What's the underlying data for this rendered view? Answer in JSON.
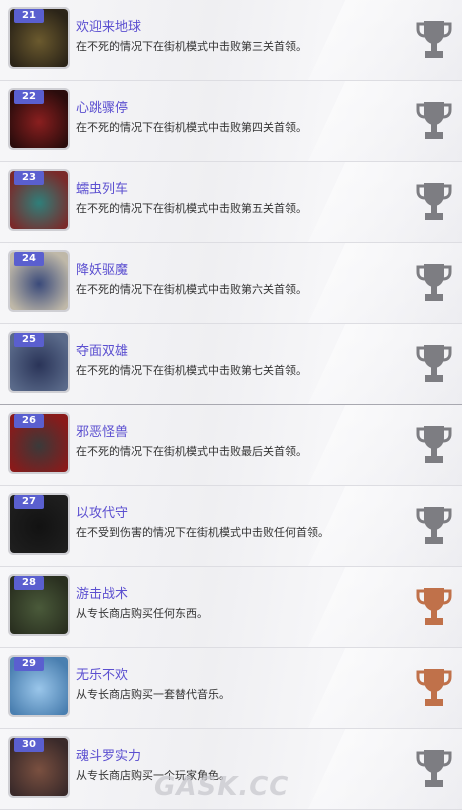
{
  "achievements": [
    {
      "num": "21",
      "title": "欢迎来地球",
      "desc": "在不死的情况下在街机模式中击败第三关首领。",
      "trophy": "silver-trophy-icon",
      "trophy_color": "#7d7d82",
      "art": [
        "#6b5a2e",
        "#2b2418"
      ]
    },
    {
      "num": "22",
      "title": "心跳骤停",
      "desc": "在不死的情况下在街机模式中击败第四关首领。",
      "trophy": "silver-trophy-icon",
      "trophy_color": "#7d7d82",
      "art": [
        "#8a1f1f",
        "#2a0c0c"
      ]
    },
    {
      "num": "23",
      "title": "蠕虫列车",
      "desc": "在不死的情况下在街机模式中击败第五关首领。",
      "trophy": "silver-trophy-icon",
      "trophy_color": "#7d7d82",
      "art": [
        "#2f7f7a",
        "#7a2a2a"
      ]
    },
    {
      "num": "24",
      "title": "降妖驱魔",
      "desc": "在不死的情况下在街机模式中击败第六关首领。",
      "trophy": "silver-trophy-icon",
      "trophy_color": "#7d7d82",
      "art": [
        "#3a4a7a",
        "#bfb8a8"
      ]
    },
    {
      "num": "25",
      "title": "夺面双雄",
      "desc": "在不死的情况下在街机模式中击败第七关首领。",
      "trophy": "silver-trophy-icon",
      "trophy_color": "#7d7d82",
      "art": [
        "#2a3458",
        "#5a6a8a"
      ]
    },
    {
      "num": "26",
      "title": "邪恶怪兽",
      "desc": "在不死的情况下在街机模式中击败最后关首领。",
      "trophy": "silver-trophy-icon",
      "trophy_color": "#7d7d82",
      "art": [
        "#3a3a3a",
        "#8a1a1a"
      ]
    },
    {
      "num": "27",
      "title": "以攻代守",
      "desc": "在不受到伤害的情况下在街机模式中击败任何首领。",
      "trophy": "silver-trophy-icon",
      "trophy_color": "#7d7d82",
      "art": [
        "#121212",
        "#1e1e1e"
      ]
    },
    {
      "num": "28",
      "title": "游击战术",
      "desc": "从专长商店购买任何东西。",
      "trophy": "bronze-trophy-icon",
      "trophy_color": "#c0714a",
      "art": [
        "#4a5a3a",
        "#2a3020"
      ]
    },
    {
      "num": "29",
      "title": "无乐不欢",
      "desc": "从专长商店购买一套替代音乐。",
      "trophy": "bronze-trophy-icon",
      "trophy_color": "#c0714a",
      "art": [
        "#9ac6ea",
        "#4a7fb0"
      ]
    },
    {
      "num": "30",
      "title": "魂斗罗实力",
      "desc": "从专长商店购买一个玩家角色。",
      "trophy": "silver-trophy-icon",
      "trophy_color": "#7d7d82",
      "art": [
        "#7a5040",
        "#3a2a2a"
      ]
    }
  ],
  "watermark": "GASK.CC"
}
